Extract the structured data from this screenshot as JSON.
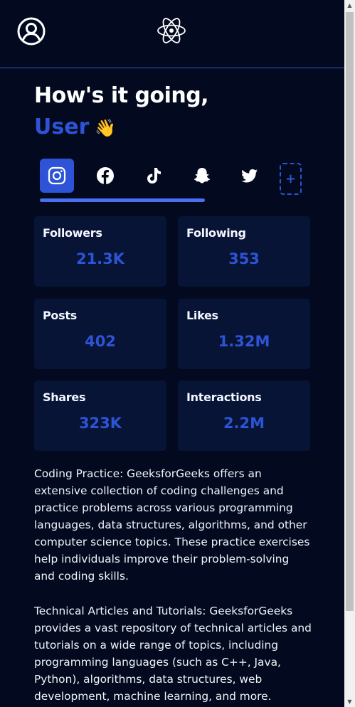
{
  "header": {
    "profile_icon": "user-circle-icon",
    "logo_icon": "react-atom-icon"
  },
  "greeting": {
    "line1": "How's it going,",
    "name": "User",
    "emoji": "👋"
  },
  "tabs": {
    "items": [
      {
        "id": "instagram",
        "icon": "instagram-icon",
        "active": true
      },
      {
        "id": "facebook",
        "icon": "facebook-icon",
        "active": false
      },
      {
        "id": "tiktok",
        "icon": "tiktok-icon",
        "active": false
      },
      {
        "id": "snapchat",
        "icon": "snapchat-icon",
        "active": false
      },
      {
        "id": "twitter",
        "icon": "twitter-icon",
        "active": false
      }
    ],
    "add_label": "+"
  },
  "stats": [
    {
      "label": "Followers",
      "value": "21.3K"
    },
    {
      "label": "Following",
      "value": "353"
    },
    {
      "label": "Posts",
      "value": "402"
    },
    {
      "label": "Likes",
      "value": "1.32M"
    },
    {
      "label": "Shares",
      "value": "323K"
    },
    {
      "label": "Interactions",
      "value": "2.2M"
    }
  ],
  "paragraphs": [
    "Coding Practice: GeeksforGeeks offers an extensive collection of coding challenges and practice problems across various programming languages, data structures, algorithms, and other computer science topics. These practice exercises help individuals improve their problem-solving and coding skills.",
    "Technical Articles and Tutorials: GeeksforGeeks provides a vast repository of technical articles and tutorials on a wide range of topics, including programming languages (such as C++, Java, Python), algorithms, data structures, web development, machine learning, and more."
  ],
  "colors": {
    "background": "#030a1f",
    "card": "#071435",
    "accent": "#2d54d6",
    "indicator": "#4a6ff0"
  }
}
